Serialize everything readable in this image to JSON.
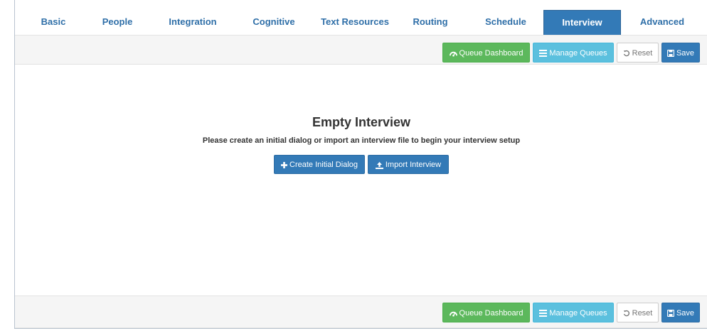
{
  "tabs": [
    {
      "label": "Basic"
    },
    {
      "label": "People"
    },
    {
      "label": "Integration"
    },
    {
      "label": "Cognitive"
    },
    {
      "label": "Text Resources"
    },
    {
      "label": "Routing"
    },
    {
      "label": "Schedule"
    },
    {
      "label": "Interview",
      "active": true
    },
    {
      "label": "Advanced"
    }
  ],
  "toolbar": {
    "queue_dashboard": "Queue Dashboard",
    "manage_queues": "Manage Queues",
    "reset": "Reset",
    "save": "Save"
  },
  "empty": {
    "title": "Empty Interview",
    "description": "Please create an initial dialog or import an interview file to begin your interview setup",
    "create_label": "Create Initial Dialog",
    "import_label": "Import Interview"
  },
  "colors": {
    "primary": "#337ab7",
    "success": "#5cb85c",
    "info": "#5bc0de",
    "tab_text": "#2f6fa8"
  }
}
